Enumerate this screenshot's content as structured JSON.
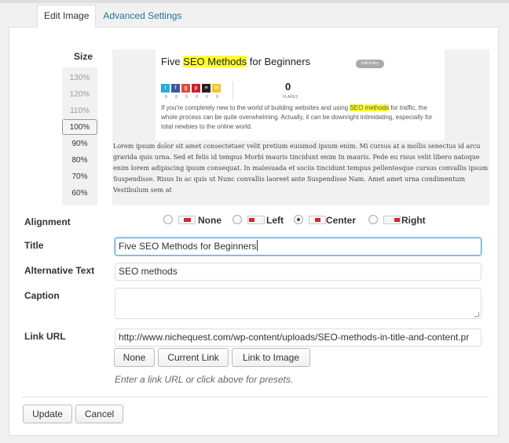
{
  "tabs": [
    {
      "label": "Edit Image",
      "active": true
    },
    {
      "label": "Advanced Settings",
      "active": false
    }
  ],
  "size": {
    "label": "Size",
    "options": [
      "130%",
      "120%",
      "110%",
      "100%",
      "90%",
      "80%",
      "70%",
      "60%"
    ],
    "selected": "100%"
  },
  "preview": {
    "title_before": "Five ",
    "title_highlight": "SEO Methods",
    "title_after": " for Beginners",
    "edit_badge": "Edit Entry",
    "social_icons": [
      "twitter-icon",
      "facebook-icon",
      "google-plus-icon",
      "pinterest-icon",
      "buffer-icon",
      "email-icon"
    ],
    "social_counts": [
      "0",
      "0",
      "0",
      "0",
      "0",
      "0"
    ],
    "flares_count": "0",
    "flares_label": "FLARES",
    "body_before": "If you're completely new to the world of building websites and using ",
    "body_highlight": "SEO methods",
    "body_after": " for traffic, the whole process can be quite overwhelming. Actually, it can be downright intimidating, especially for total newbies to the online world.",
    "lorem": "Lorem ipsum dolor sit amet consectetuer velit pretium euismod ipsum enim. Mi cursus at a mollis senectus id arcu gravida quis urna. Sed et felis id tempus Morbi mauris tincidunt enim In mauris. Pede eu risus velit libero natoque enim lorem adipiscing ipsum consequat. In malesuada et sociis tincidunt tempus pellentesque cursus convallis ipsum Suspendisse. Risus In ac quis ut Nunc convallis laoreet ante Suspendisse Nam. Amet amet urna condimentum Vestibulum sem at"
  },
  "alignment": {
    "label": "Alignment",
    "options": [
      {
        "label": "None",
        "icon": "align-none-icon",
        "checked": false
      },
      {
        "label": "Left",
        "icon": "align-left-icon",
        "checked": false
      },
      {
        "label": "Center",
        "icon": "align-center-icon",
        "checked": true
      },
      {
        "label": "Right",
        "icon": "align-right-icon",
        "checked": false
      }
    ]
  },
  "title": {
    "label": "Title",
    "value": "Five SEO Methods for Beginners"
  },
  "alt_text": {
    "label": "Alternative Text",
    "value": "SEO methods"
  },
  "caption": {
    "label": "Caption",
    "value": ""
  },
  "link_url": {
    "label": "Link URL",
    "value": "http://www.nichequest.com/wp-content/uploads/SEO-methods-in-title-and-content.pr",
    "presets": [
      "None",
      "Current Link",
      "Link to Image"
    ],
    "hint": "Enter a link URL or click above for presets."
  },
  "actions": {
    "update": "Update",
    "cancel": "Cancel"
  },
  "colors": {
    "link": "#21759b",
    "highlight": "#ffff33",
    "focus": "#5b9dd9"
  }
}
